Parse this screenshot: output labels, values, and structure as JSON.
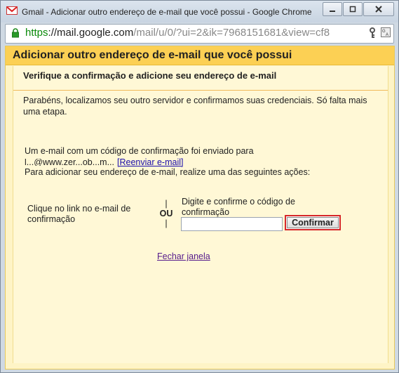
{
  "window": {
    "title": "Gmail - Adicionar outro endereço de e-mail que você possui - Google Chrome",
    "controls": [
      "minimize",
      "restore",
      "close"
    ]
  },
  "address_bar": {
    "scheme": "https",
    "host": "://mail.google.com",
    "path": "/mail/u/0/?ui=2&ik=7968151681&view=cf8",
    "icons": [
      "key-icon",
      "translate-icon"
    ]
  },
  "dialog": {
    "title": "Adicionar outro endereço de e-mail que você possui",
    "subtitle": "Verifique a confirmação e adicione seu endereço de e-mail",
    "congrats": "Parabéns, localizamos seu outro servidor e confirmamos suas credenciais. Só falta mais uma etapa.",
    "code_sent": "Um e-mail com um código de confirmação foi enviado para",
    "email_obscured": "l...@www.zer...ob...m...",
    "resend_link": "[Reenviar e-mail]",
    "instructions": "Para adicionar seu endereço de e-mail, realize uma das seguintes ações:",
    "option_link": "Clique no link no e-mail de confirmação",
    "or_bar_top": "|",
    "or_text": "OU",
    "or_bar_bottom": "|",
    "code_label": "Digite e confirme o código de confirmação",
    "code_input_value": "",
    "confirm_button": "Confirmar",
    "close_link": "Fechar janela",
    "colors": {
      "header_bg": "#fcd054",
      "body_bg": "#fff8d6",
      "highlight_border": "#d6272a"
    }
  }
}
